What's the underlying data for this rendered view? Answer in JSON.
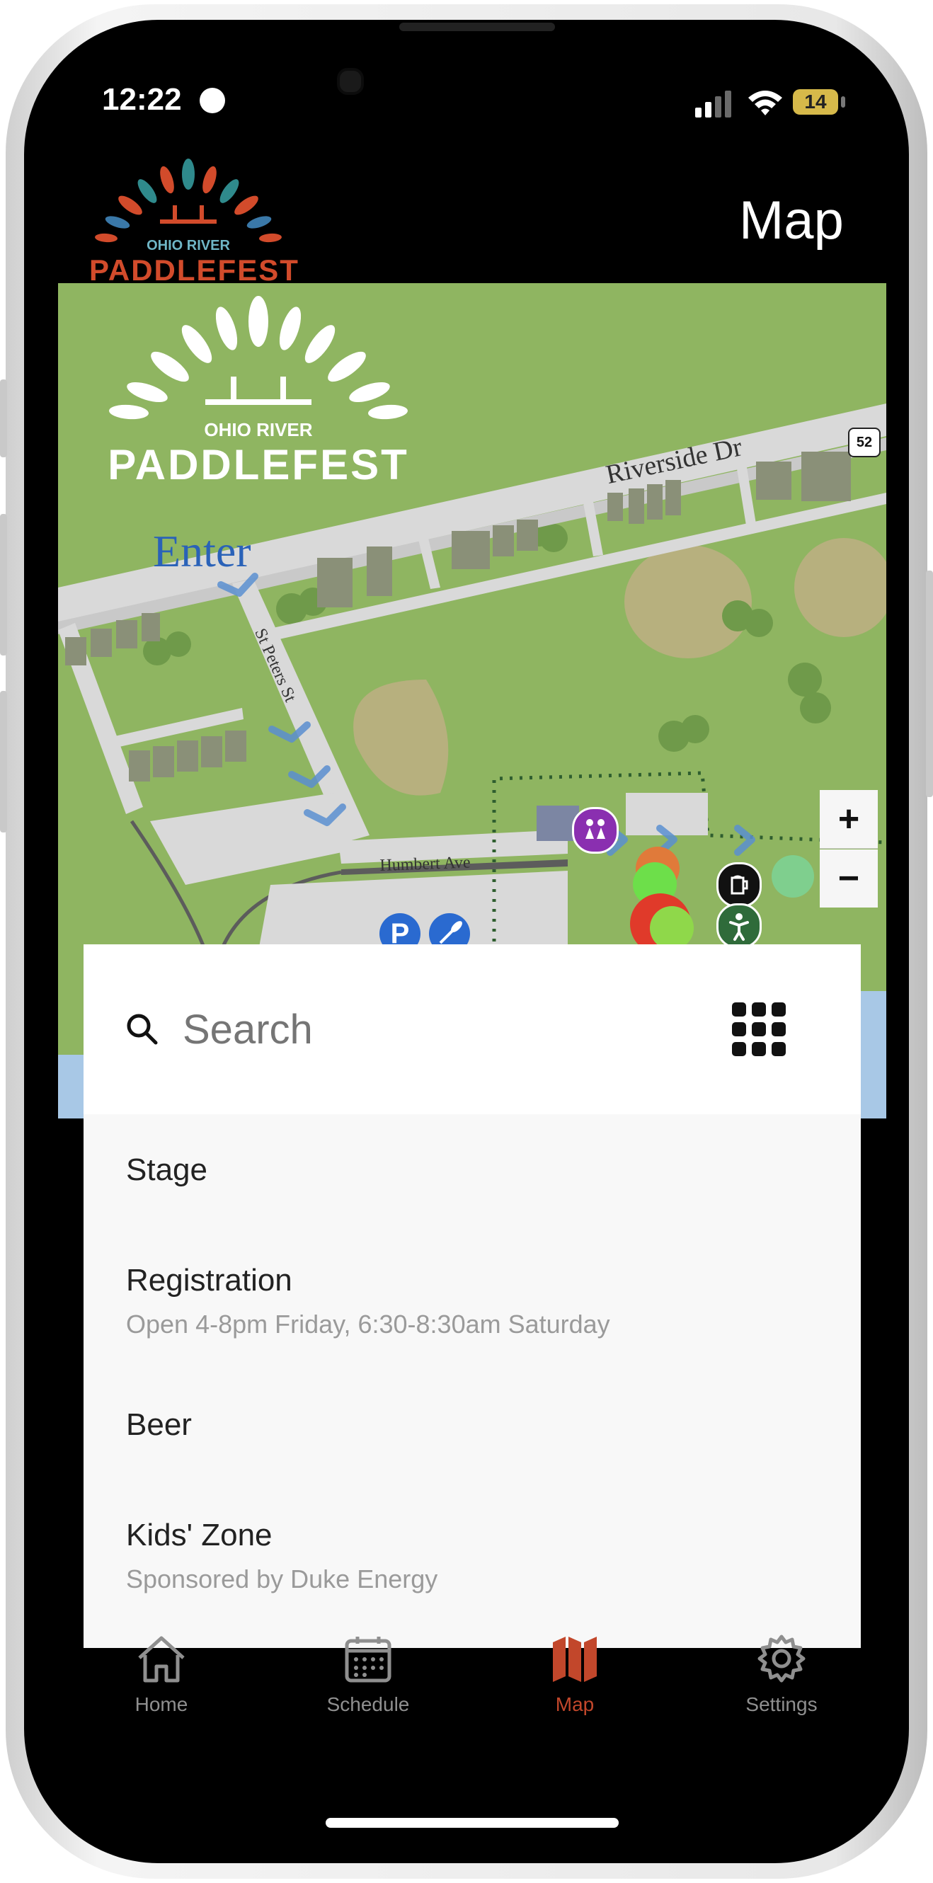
{
  "status": {
    "time": "12:22",
    "battery": "14"
  },
  "header": {
    "logo_top": "OHIO RIVER",
    "logo_main": "PADDLEFEST",
    "title": "Map"
  },
  "map": {
    "logo_top": "OHIO RIVER",
    "logo_main": "PADDLEFEST",
    "enter_label": "Enter",
    "road_riverside": "Riverside Dr",
    "road_stpeters": "St Peters St",
    "road_humbert": "Humbert Ave",
    "route_shield": "52",
    "zoom_in": "+",
    "zoom_out": "−"
  },
  "search": {
    "placeholder": "Search"
  },
  "locations": [
    {
      "title": "Stage",
      "subtitle": ""
    },
    {
      "title": "Registration",
      "subtitle": "Open 4-8pm Friday, 6:30-8:30am Saturday"
    },
    {
      "title": "Beer",
      "subtitle": ""
    },
    {
      "title": "Kids' Zone",
      "subtitle": "Sponsored by Duke Energy"
    }
  ],
  "tabs": [
    {
      "label": "Home",
      "icon": "home-icon",
      "active": false
    },
    {
      "label": "Schedule",
      "icon": "calendar-icon",
      "active": false
    },
    {
      "label": "Map",
      "icon": "map-icon",
      "active": true
    },
    {
      "label": "Settings",
      "icon": "gear-icon",
      "active": false
    }
  ],
  "colors": {
    "accent": "#c2472b",
    "map_grass": "#8fb561",
    "road": "#d9d9d9",
    "inactive_tab": "#8f8f8f"
  }
}
